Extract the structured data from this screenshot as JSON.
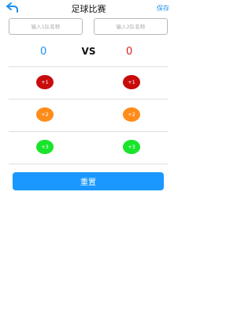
{
  "header": {
    "title": "足球比赛",
    "save_label": "保存"
  },
  "team_inputs": {
    "team1_placeholder": "输入1队名称",
    "team2_placeholder": "输入2队名称"
  },
  "scoreboard": {
    "team1_score": "0",
    "vs_label": "VS",
    "team2_score": "0"
  },
  "point_buttons": {
    "plus1": "+1",
    "plus2": "+2",
    "plus3": "+3"
  },
  "reset_label": "重置",
  "colors": {
    "accent": "#1a98ff",
    "team1_score": "#1a8ff0",
    "team2_score": "#d71f1f",
    "plus1": "#c80b0b",
    "plus2": "#ff8c1a",
    "plus3": "#19e42b"
  }
}
